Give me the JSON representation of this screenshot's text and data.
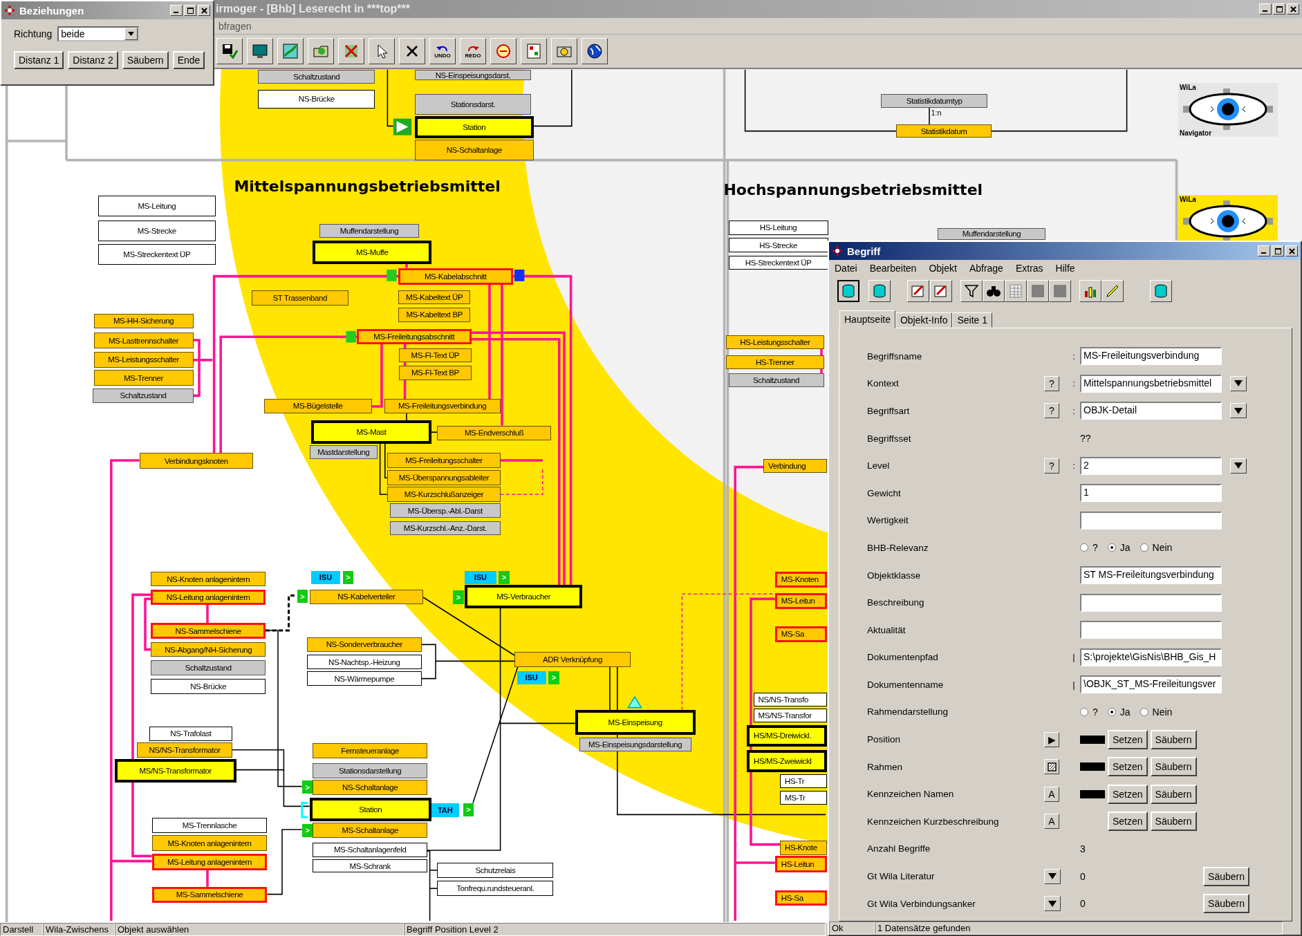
{
  "main_window": {
    "title": "irmoger  -  [Bhb] Leserecht in ***top***",
    "menu": [
      "bfragen"
    ],
    "toolbar": {
      "undo_label": "UNDO",
      "redo_label": "REDO"
    }
  },
  "relations_dialog": {
    "title": "Beziehungen",
    "direction_label": "Richtung",
    "direction_value": "beide",
    "buttons": [
      "Distanz 1",
      "Distanz 2",
      "Säubern",
      "Ende"
    ]
  },
  "diagram": {
    "headings": [
      "Mittelspannungsbetriebsmittel",
      "Hochspannungsbetriebsmittel"
    ],
    "nodes": [
      {
        "label": "Schaltzustand",
        "kind": "gray"
      },
      {
        "label": "NS-Brücke",
        "kind": "plain"
      },
      {
        "label": "NS-Einspeisungsdarst.",
        "kind": "gray"
      },
      {
        "label": "Stationsdarst.",
        "kind": "gray"
      },
      {
        "label": "Station",
        "kind": "main"
      },
      {
        "label": "NS-Schaltanlage",
        "kind": "orange"
      },
      {
        "label": "Statistikdatumtyp",
        "kind": "gray"
      },
      {
        "label": "Statistikdatum",
        "kind": "orange"
      },
      {
        "label": "MS-Leitung",
        "kind": "plain"
      },
      {
        "label": "MS-Strecke",
        "kind": "plain"
      },
      {
        "label": "MS-Streckentext ÜP",
        "kind": "plain"
      },
      {
        "label": "Muffendarstellung",
        "kind": "gray"
      },
      {
        "label": "MS-Muffe",
        "kind": "main"
      },
      {
        "label": "MS-Kabelabschnitt",
        "kind": "red"
      },
      {
        "label": "ST Trassenband",
        "kind": "orange"
      },
      {
        "label": "MS-Kabeltext ÜP",
        "kind": "orange"
      },
      {
        "label": "MS-Kabeltext BP",
        "kind": "orange"
      },
      {
        "label": "MS-HH-Sicherung",
        "kind": "orange"
      },
      {
        "label": "MS-Lasttrennschalter",
        "kind": "orange"
      },
      {
        "label": "MS-Leistungsschalter",
        "kind": "orange"
      },
      {
        "label": "MS-Trenner",
        "kind": "orange"
      },
      {
        "label": "Schaltzustand",
        "kind": "gray"
      },
      {
        "label": "MS-Freileitungsabschnitt",
        "kind": "red"
      },
      {
        "label": "MS-Fl-Text ÜP",
        "kind": "orange"
      },
      {
        "label": "MS-Fl-Text BP",
        "kind": "orange"
      },
      {
        "label": "MS-Bügelstelle",
        "kind": "orange"
      },
      {
        "label": "MS-Freileitungsverbindung",
        "kind": "orange"
      },
      {
        "label": "MS-Mast",
        "kind": "main"
      },
      {
        "label": "MS-Endverschluß",
        "kind": "orange"
      },
      {
        "label": "Mastdarstellung",
        "kind": "gray"
      },
      {
        "label": "Verbindungsknoten",
        "kind": "orange"
      },
      {
        "label": "MS-Freileitungsschalter",
        "kind": "orange"
      },
      {
        "label": "MS-Überspannungsableiter",
        "kind": "orange"
      },
      {
        "label": "MS-Kurzschlußanzeiger",
        "kind": "orange"
      },
      {
        "label": "MS-Übersp.-Abl.-Darst",
        "kind": "gray"
      },
      {
        "label": "MS-Kurzschl.-Anz.-Darst.",
        "kind": "gray"
      },
      {
        "label": "NS-Knoten anlagenintern",
        "kind": "orange"
      },
      {
        "label": "NS-Leitung anlagenintern",
        "kind": "red"
      },
      {
        "label": "NS-Kabelverteiler",
        "kind": "orange"
      },
      {
        "label": "MS-Verbraucher",
        "kind": "main"
      },
      {
        "label": "NS-Sammelschiene",
        "kind": "red"
      },
      {
        "label": "NS-Abgang/NH-Sicherung",
        "kind": "orange"
      },
      {
        "label": "Schaltzustand",
        "kind": "gray"
      },
      {
        "label": "NS-Brücke",
        "kind": "plain"
      },
      {
        "label": "NS-Sonderverbraucher",
        "kind": "orange"
      },
      {
        "label": "NS-Nachtsp.-Heizung",
        "kind": "plain"
      },
      {
        "label": "NS-Wärmepumpe",
        "kind": "plain"
      },
      {
        "label": "ADR Verknüpfung",
        "kind": "orange"
      },
      {
        "label": "MS-Einspeisung",
        "kind": "main"
      },
      {
        "label": "MS-Einspeisungsdarstellung",
        "kind": "gray"
      },
      {
        "label": "NS-Trafolast",
        "kind": "plain"
      },
      {
        "label": "NS/NS-Transformator",
        "kind": "orange"
      },
      {
        "label": "MS/NS-Transformator",
        "kind": "main"
      },
      {
        "label": "Fernsteueranlage",
        "kind": "orange"
      },
      {
        "label": "Stationsdarstellung",
        "kind": "gray"
      },
      {
        "label": "NS-Schaltanlage",
        "kind": "orange"
      },
      {
        "label": "Station",
        "kind": "main"
      },
      {
        "label": "MS-Trennlasche",
        "kind": "plain"
      },
      {
        "label": "MS-Schaltanlage",
        "kind": "orange"
      },
      {
        "label": "MS-Knoten anlagenintern",
        "kind": "orange"
      },
      {
        "label": "MS-Schaltanlagenfeld",
        "kind": "plain"
      },
      {
        "label": "MS-Schrank",
        "kind": "plain"
      },
      {
        "label": "MS-Leitung anlagenintern",
        "kind": "red"
      },
      {
        "label": "Schutzrelais",
        "kind": "plain"
      },
      {
        "label": "Tonfrequ.rundsteueranl.",
        "kind": "plain"
      },
      {
        "label": "MS-Sammelschiene",
        "kind": "red"
      },
      {
        "label": "HS-Leitung",
        "kind": "plain"
      },
      {
        "label": "HS-Strecke",
        "kind": "plain"
      },
      {
        "label": "HS-Streckentext ÜP",
        "kind": "plain"
      },
      {
        "label": "Muffendarstellung",
        "kind": "gray"
      },
      {
        "label": "HS-Leistungsschalter",
        "kind": "orange"
      },
      {
        "label": "HS-Trenner",
        "kind": "orange"
      },
      {
        "label": "Schaltzustand",
        "kind": "gray"
      },
      {
        "label": "Verbindung",
        "kind": "orange"
      },
      {
        "label": "MS-Knoten",
        "kind": "red"
      },
      {
        "label": "MS-Leitun",
        "kind": "red"
      },
      {
        "label": "MS-Sa",
        "kind": "red"
      },
      {
        "label": "NS/NS-Transfo",
        "kind": "plain"
      },
      {
        "label": "MS/NS-Transfor",
        "kind": "plain"
      },
      {
        "label": "HS/MS-Dreiwickl.",
        "kind": "main"
      },
      {
        "label": "HS/MS-Zweiwickl",
        "kind": "main"
      },
      {
        "label": "HS-Tr",
        "kind": "plain"
      },
      {
        "label": "MS-Tr",
        "kind": "plain"
      },
      {
        "label": "HS-Knote",
        "kind": "orange"
      },
      {
        "label": "HS-Leitun",
        "kind": "red"
      },
      {
        "label": "HS-Sa",
        "kind": "red"
      }
    ],
    "tags": [
      {
        "text": "ISU",
        "kind": "isu"
      },
      {
        "text": ">",
        "kind": "go"
      },
      {
        "text": "ISU",
        "kind": "isu"
      },
      {
        "text": ">",
        "kind": "go"
      },
      {
        "text": ">",
        "kind": "go"
      },
      {
        "text": ">",
        "kind": "go"
      },
      {
        "text": "ISU",
        "kind": "isu"
      },
      {
        "text": ">",
        "kind": "go"
      },
      {
        "text": ">",
        "kind": "go"
      },
      {
        "text": "TAH",
        "kind": "isu"
      },
      {
        "text": ">",
        "kind": "go"
      },
      {
        "text": ">",
        "kind": "go"
      }
    ],
    "cardinality": "1:n",
    "navigators": [
      {
        "title": "WiLa",
        "caption": "Navigator",
        "highlighted": false
      },
      {
        "title": "WiLa",
        "highlighted": true
      }
    ]
  },
  "term_dialog": {
    "title": "Begriff",
    "menu": [
      "Datei",
      "Bearbeiten",
      "Objekt",
      "Abfrage",
      "Extras",
      "Hilfe"
    ],
    "tabs": [
      {
        "label": "Hauptseite",
        "selected": true
      },
      {
        "label": "Objekt-Info",
        "selected": false
      },
      {
        "label": "Seite 1",
        "selected": false
      }
    ],
    "fields": [
      {
        "kind": "text",
        "label": "Begriffsname",
        "separator": ":",
        "value": "MS-Freileitungsverbindung"
      },
      {
        "kind": "text",
        "label": "Kontext",
        "help": "?",
        "separator": ":",
        "value": "Mittelspannungsbetriebsmittel",
        "dropdown": true
      },
      {
        "kind": "text",
        "label": "Begriffsart",
        "help": "?",
        "separator": ":",
        "value": "OBJK-Detail",
        "dropdown": true
      },
      {
        "kind": "static",
        "label": "Begriffsset",
        "value": "??"
      },
      {
        "kind": "text",
        "label": "Level",
        "help": "?",
        "separator": ":",
        "value": "2",
        "dropdown": true
      },
      {
        "kind": "text",
        "label": "Gewicht",
        "value": "1"
      },
      {
        "kind": "text",
        "label": "Wertigkeit"
      },
      {
        "kind": "radio",
        "label": "BHB-Relevanz",
        "options": [
          {
            "label": "?",
            "selected": false
          },
          {
            "label": "Ja",
            "selected": true
          },
          {
            "label": "Nein",
            "selected": false
          }
        ]
      },
      {
        "kind": "text",
        "label": "Objektklasse",
        "value": "ST MS-Freileitungsverbindung"
      },
      {
        "kind": "text",
        "label": "Beschreibung"
      },
      {
        "kind": "text",
        "label": "Aktualität"
      },
      {
        "kind": "text",
        "label": "Dokumentenpfad",
        "separator": "|",
        "value": "S:\\projekte\\GisNis\\BHB_Gis_H"
      },
      {
        "kind": "text",
        "label": "Dokumentenname",
        "separator": "|",
        "value": "\\OBJK_ST_MS-Freileitungsver"
      },
      {
        "kind": "radio",
        "label": "Rahmendarstellung",
        "options": [
          {
            "label": "?",
            "selected": false
          },
          {
            "label": "Ja",
            "selected": true
          },
          {
            "label": "Nein",
            "selected": false
          }
        ]
      },
      {
        "kind": "style",
        "label": "Position",
        "glyph": "▶",
        "swatch": true,
        "buttons": [
          "Setzen",
          "Säubern"
        ]
      },
      {
        "kind": "style",
        "label": "Rahmen",
        "swatch": true,
        "buttons": [
          "Setzen",
          "Säubern"
        ]
      },
      {
        "kind": "style",
        "label": "Kennzeichen Namen",
        "glyph": "A",
        "swatch": true,
        "buttons": [
          "Setzen",
          "Säubern"
        ]
      },
      {
        "kind": "style",
        "label": "Kennzeichen Kurzbeschreibung",
        "glyph": "A",
        "swatch": false,
        "buttons": [
          "Setzen",
          "Säubern"
        ]
      },
      {
        "kind": "static",
        "label": "Anzahl Begriffe",
        "value": "3"
      },
      {
        "kind": "count",
        "label": "Gt Wila Literatur",
        "value": "0",
        "buttons": [
          "Säubern"
        ]
      },
      {
        "kind": "count",
        "label": "Gt Wila Verbindungsanker",
        "value": "0",
        "buttons": [
          "Säubern"
        ]
      }
    ],
    "status": [
      "Ok",
      "1 Datensätze gefunden"
    ]
  },
  "status_bar": [
    "Darstell",
    "Wila-Zwischens",
    "Objekt auswählen",
    "Begriff Position Level 2"
  ]
}
